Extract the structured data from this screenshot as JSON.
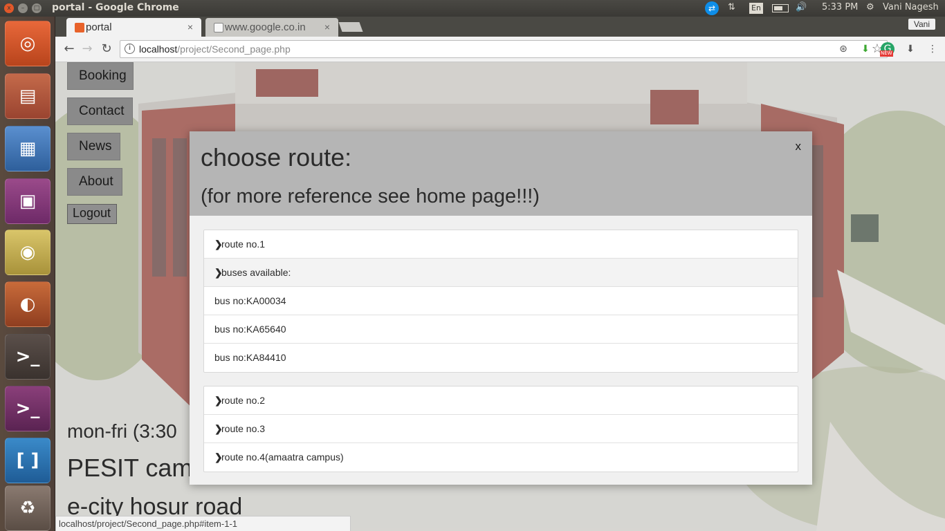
{
  "os": {
    "window_title": "portal - Google Chrome",
    "window_buttons": {
      "close": "x",
      "minimize": "–",
      "maximize": "□"
    },
    "tray": {
      "teamviewer_icon": "⇄",
      "network_icon": "⇅",
      "keyboard_layout": "En",
      "volume_icon": "🔊",
      "time": "5:33 PM",
      "settings_icon": "⚙",
      "user": "Vani Nagesh"
    },
    "launcher": [
      {
        "name": "ubuntu-dash",
        "glyph": "◎"
      },
      {
        "name": "files",
        "glyph": "▤"
      },
      {
        "name": "libreoffice-writer",
        "glyph": "▦"
      },
      {
        "name": "app-purple",
        "glyph": "▣"
      },
      {
        "name": "chrome",
        "glyph": "◉"
      },
      {
        "name": "firefox",
        "glyph": "◐"
      },
      {
        "name": "terminal",
        "glyph": ">_"
      },
      {
        "name": "terminal-2",
        "glyph": ">_"
      },
      {
        "name": "brackets",
        "glyph": "[ ]"
      },
      {
        "name": "trash",
        "glyph": "♻"
      }
    ]
  },
  "browser": {
    "tabs": [
      {
        "title": "portal",
        "close": "×",
        "active": true
      },
      {
        "title": "www.google.co.in",
        "close": "×",
        "active": false
      }
    ],
    "profile": "Vani",
    "nav": {
      "back": "←",
      "forward": "→",
      "reload": "↻"
    },
    "address": {
      "host": "localhost",
      "path": "/project/Second_page.php",
      "info_icon": "i",
      "star_icon": "☆"
    },
    "extensions": [
      {
        "name": "ext-1",
        "glyph": "⊛"
      },
      {
        "name": "ext-2",
        "glyph": "⬇"
      },
      {
        "name": "ext-3",
        "glyph": "G",
        "badge": "NEW"
      },
      {
        "name": "ext-4",
        "glyph": "⬇"
      },
      {
        "name": "menu",
        "glyph": "⋮"
      }
    ],
    "status_url": "localhost/project/Second_page.php#item-1-1"
  },
  "page": {
    "nav": {
      "booking": "Booking",
      "contact": "Contact",
      "news": "News",
      "about": "About",
      "logout": "Logout"
    },
    "background_text": {
      "timing": "mon-fri (3:30",
      "campus": "PESIT cam",
      "road": "e-city hosur road"
    },
    "modal": {
      "title": "choose route:",
      "subtitle": "(for more reference see home page!!!)",
      "close": "x",
      "chevron": "❯",
      "route1": {
        "label": "route no.1",
        "buses_label": "buses available:",
        "buses": [
          "bus no:KA00034",
          "bus no:KA65640",
          "bus no:KA84410"
        ]
      },
      "other_routes": [
        "route no.2",
        "route no.3",
        "route no.4(amaatra campus)"
      ]
    }
  }
}
